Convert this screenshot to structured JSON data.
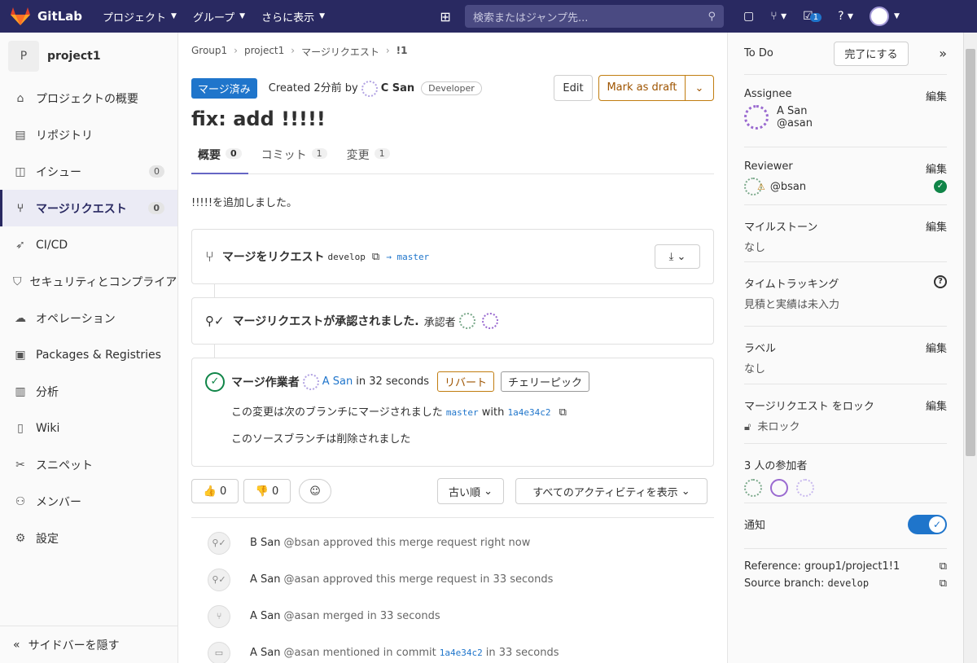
{
  "topbar": {
    "brand": "GitLab",
    "nav": [
      "プロジェクト",
      "グループ",
      "さらに表示"
    ],
    "search_placeholder": "検索またはジャンプ先...",
    "todo_count": "1"
  },
  "sidebar": {
    "project_initial": "P",
    "project_name": "project1",
    "items": [
      {
        "label": "プロジェクトの概要",
        "icon": "home-icon"
      },
      {
        "label": "リポジトリ",
        "icon": "doc-icon"
      },
      {
        "label": "イシュー",
        "icon": "issues-icon",
        "count": "0"
      },
      {
        "label": "マージリクエスト",
        "icon": "merge-request-icon",
        "count": "0"
      },
      {
        "label": "CI/CD",
        "icon": "rocket-icon"
      },
      {
        "label": "セキュリティとコンプライアンス",
        "icon": "shield-icon"
      },
      {
        "label": "オペレーション",
        "icon": "cloud-icon"
      },
      {
        "label": "Packages & Registries",
        "icon": "package-icon"
      },
      {
        "label": "分析",
        "icon": "chart-icon"
      },
      {
        "label": "Wiki",
        "icon": "book-icon"
      },
      {
        "label": "スニペット",
        "icon": "scissors-icon"
      },
      {
        "label": "メンバー",
        "icon": "users-icon"
      },
      {
        "label": "設定",
        "icon": "gear-icon"
      }
    ],
    "collapse": "サイドバーを隠す"
  },
  "breadcrumb": [
    "Group1",
    "project1",
    "マージリクエスト",
    "!1"
  ],
  "mr": {
    "status": "マージ済み",
    "created": "Created 2分前 by",
    "author": "C San",
    "role": "Developer",
    "edit": "Edit",
    "draft": "Mark as draft",
    "title": "fix: add !!!!!",
    "tabs": [
      {
        "label": "概要",
        "count": "0"
      },
      {
        "label": "コミット",
        "count": "1"
      },
      {
        "label": "変更",
        "count": "1"
      }
    ],
    "description": "!!!!!を追加しました。",
    "request_label": "マージをリクエスト",
    "source_branch": "develop",
    "arrow_target": "→ master",
    "approved_text": "マージリクエストが承認されました.",
    "approvers_label": "承認者",
    "merged_by_label": "マージ作業者",
    "merged_by": "A San",
    "merged_time": "in 32 seconds",
    "revert": "リバート",
    "cherry": "チェリーピック",
    "merged_into": "この変更は次のブランチにマージされました",
    "target_branch": "master",
    "with": "with",
    "commit": "1a4e34c2",
    "source_deleted": "このソースブランチは削除されました",
    "thumbs_up": "0",
    "thumbs_down": "0",
    "sort": "古い順",
    "filter": "すべてのアクティビティを表示",
    "activity": [
      {
        "name": "B San",
        "user": "@bsan",
        "text": "approved this merge request right now"
      },
      {
        "name": "A San",
        "user": "@asan",
        "text": "approved this merge request in 33 seconds"
      },
      {
        "name": "A San",
        "user": "@asan",
        "text": "merged in 33 seconds"
      },
      {
        "name": "A San",
        "user": "@asan",
        "text": "mentioned in commit",
        "commit": "1a4e34c2",
        "tail": "in 33 seconds"
      }
    ]
  },
  "right": {
    "todo": "To Do",
    "done": "完了にする",
    "assignee_label": "Assignee",
    "edit": "編集",
    "assignee_name": "A San",
    "assignee_user": "@asan",
    "reviewer_label": "Reviewer",
    "reviewer_user": "@bsan",
    "milestone_label": "マイルストーン",
    "none": "なし",
    "time_label": "タイムトラッキング",
    "time_value": "見積と実績は未入力",
    "labels_label": "ラベル",
    "lock_label": "マージリクエスト をロック",
    "lock_value": "未ロック",
    "participants": "3 人の参加者",
    "notify": "通知",
    "reference": "Reference: group1/project1!1",
    "source_label": "Source branch:",
    "source_value": "develop"
  }
}
